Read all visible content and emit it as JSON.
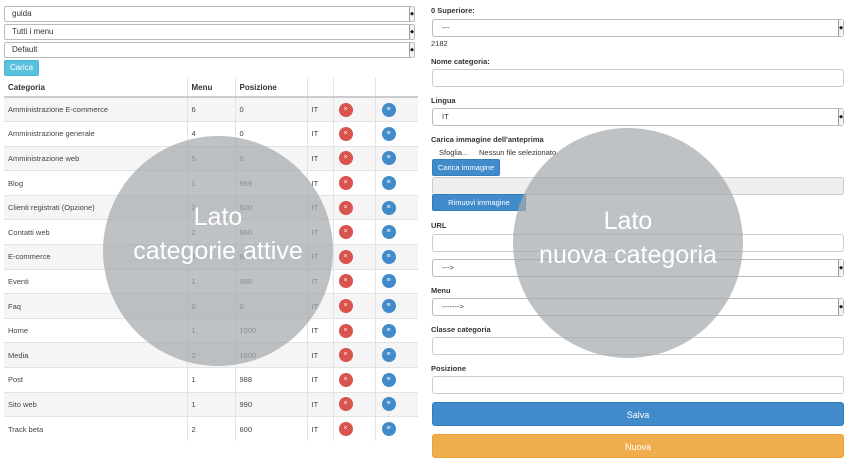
{
  "left": {
    "filters": [
      {
        "value": "guida"
      },
      {
        "value": "Tutti i menu"
      },
      {
        "value": "Default"
      }
    ],
    "load_button": "Carica",
    "table": {
      "headers": [
        "Categoria",
        "Menu",
        "Posizione",
        "",
        "",
        ""
      ],
      "rows": [
        {
          "categoria": "Amministrazione E-commerce",
          "menu": "6",
          "posizione": "0",
          "lingua": "IT"
        },
        {
          "categoria": "Amministrazione generale",
          "menu": "4",
          "posizione": "0",
          "lingua": "IT"
        },
        {
          "categoria": "Amministrazione web",
          "menu": "5",
          "posizione": "0",
          "lingua": "IT"
        },
        {
          "categoria": "Blog",
          "menu": "1",
          "posizione": "989",
          "lingua": "IT"
        },
        {
          "categoria": "Clienti registrati (Opzione)",
          "menu": "2",
          "posizione": "600",
          "lingua": "IT"
        },
        {
          "categoria": "Contatti web",
          "menu": "2",
          "posizione": "960",
          "lingua": "IT"
        },
        {
          "categoria": "E-commerce",
          "menu": "1",
          "posizione": "987",
          "lingua": "IT"
        },
        {
          "categoria": "Eventi",
          "menu": "1",
          "posizione": "986",
          "lingua": "IT"
        },
        {
          "categoria": "Faq",
          "menu": "0",
          "posizione": "0",
          "lingua": "IT"
        },
        {
          "categoria": "Home",
          "menu": "1",
          "posizione": "1000",
          "lingua": "IT"
        },
        {
          "categoria": "Media",
          "menu": "2",
          "posizione": "1000",
          "lingua": "IT"
        },
        {
          "categoria": "Post",
          "menu": "1",
          "posizione": "988",
          "lingua": "IT"
        },
        {
          "categoria": "Sito web",
          "menu": "1",
          "posizione": "990",
          "lingua": "IT"
        },
        {
          "categoria": "Track beta",
          "menu": "2",
          "posizione": "600",
          "lingua": "IT"
        }
      ],
      "delete_icon": "×",
      "list_icon": "≡"
    },
    "overlay": {
      "line1": "Lato",
      "line2": "categorie attive"
    }
  },
  "right": {
    "superiore_label": "0 Superiore:",
    "superiore_value": "---",
    "superiore_id": "2182",
    "nome_label": "Nome categoria:",
    "nome_value": "",
    "lingua_label": "Lingua",
    "lingua_value": "IT",
    "image_label": "Carica immagine dell'anteprima",
    "browse_label": "Sfoglia...",
    "no_file_label": "Nessun file selezionato.",
    "upload_button": "Carica immagine",
    "remove_button": "Rimuovi immagine",
    "url_label": "URL",
    "url_value": "",
    "url_select": "--->",
    "menu_label": "Menu",
    "menu_select": "------->",
    "classe_label": "Classe categoria",
    "classe_value": "",
    "posizione_label": "Posizione",
    "posizione_value": "",
    "save_button": "Salva",
    "new_button": "Nuova",
    "overlay": {
      "line1": "Lato",
      "line2": "nuova categoria"
    }
  },
  "colors": {
    "primary": "#428bca",
    "info": "#5bc0de",
    "danger": "#d9534f",
    "warning": "#f0ad4e"
  },
  "icons": {
    "select_arrow": "◆"
  }
}
